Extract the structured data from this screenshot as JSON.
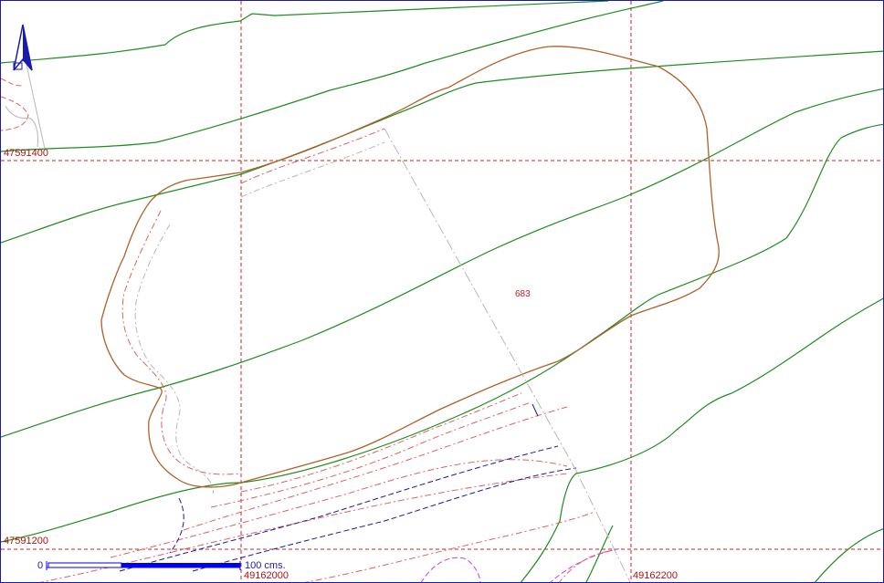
{
  "map": {
    "parcel_label": "683",
    "north_arrow_icon": "north-arrow-icon",
    "coords": {
      "y_top": "47591400",
      "y_bottom": "47591200",
      "x_left": "49162000",
      "x_right": "49162200"
    },
    "scale": {
      "start": "0",
      "end": "100",
      "unit": "cms."
    },
    "colors": {
      "grid": "#d02020",
      "contour": "#1e8c1e",
      "parcel": "#b0602a",
      "frame": "#1a1ab0",
      "scale_bar": "#0000ee"
    }
  }
}
